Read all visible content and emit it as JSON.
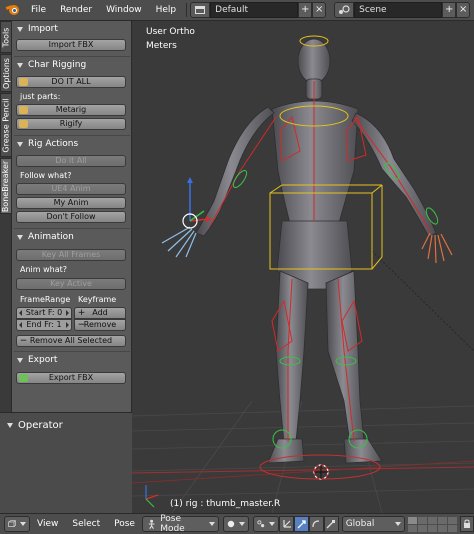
{
  "topbar": {
    "menus": [
      "File",
      "Render",
      "Window",
      "Help"
    ],
    "screen_layout": "Default",
    "scene": "Scene"
  },
  "tabs": [
    "Tools",
    "Options",
    "Grease Pencil",
    "BoneBreaker"
  ],
  "panel": {
    "import": {
      "title": "Import",
      "import_fbx": "Import FBX"
    },
    "char_rigging": {
      "title": "Char Rigging",
      "do_it_all": "DO IT ALL",
      "just_parts": "just parts:",
      "metarig": "Metarig",
      "rigify": "Rigify"
    },
    "rig_actions": {
      "title": "Rig Actions",
      "do_it_all": "Do it All",
      "follow_what": "Follow what?",
      "ue4_anim": "UE4 Anim",
      "my_anim": "My Anim",
      "dont_follow": "Don't Follow"
    },
    "animation": {
      "title": "Animation",
      "key_all_frames": "Key All Frames",
      "anim_what": "Anim what?",
      "key_active": "Key Active",
      "frame_range": "FrameRange",
      "keyframe": "Keyframe",
      "start_label": "Start F: 0",
      "end_label": "End Fr: 1",
      "add": "Add",
      "remove": "Remove",
      "remove_all_selected": "Remove All Selected"
    },
    "export": {
      "title": "Export",
      "export_fbx": "Export FBX"
    },
    "operator": {
      "title": "Operator"
    }
  },
  "viewport": {
    "view_name": "User Ortho",
    "units": "Meters",
    "status": "(1) rig : thumb_master.R"
  },
  "bottombar": {
    "view": "View",
    "select": "Select",
    "pose": "Pose",
    "mode": "Pose Mode",
    "orientation": "Global"
  },
  "colors": {
    "accent_blue": "#5680c2",
    "blender_orange": "#e87d0d",
    "panel_bg": "#5a5a5a",
    "viewport_bg": "#3a3a3a"
  }
}
